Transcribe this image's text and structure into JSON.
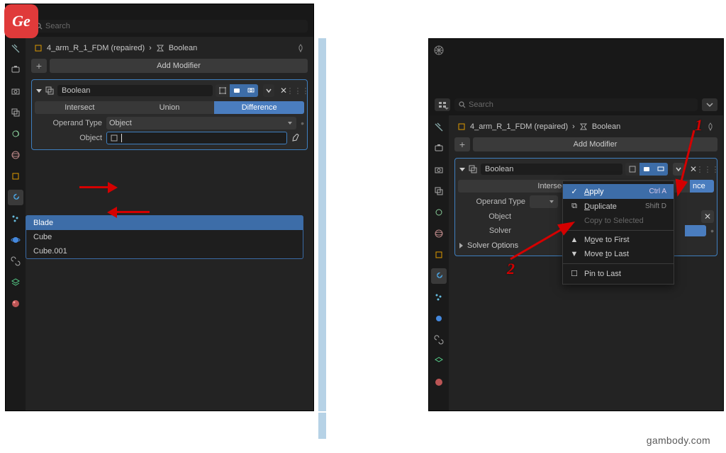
{
  "search_placeholder": "Search",
  "breadcrumb": {
    "object": "4_arm_R_1_FDM (repaired)",
    "modifier": "Boolean"
  },
  "add_modifier_label": "Add Modifier",
  "modifier": {
    "name": "Boolean",
    "operations": [
      "Intersect",
      "Union",
      "Difference"
    ],
    "active_op_index": 2,
    "operand_type_label": "Operand Type",
    "operand_type_value": "Object",
    "object_label": "Object",
    "object_value": "",
    "solver_label": "Solver",
    "solver_options_label": "Solver Options"
  },
  "popup_objects": [
    "Blade",
    "Cube",
    "Cube.001"
  ],
  "context_menu": [
    {
      "type": "item",
      "icon": "check",
      "label": "Apply",
      "shortcut": "Ctrl A",
      "sel": true,
      "underline": 0
    },
    {
      "type": "item",
      "icon": "dup",
      "label": "Duplicate",
      "shortcut": "Shift D",
      "underline": 0
    },
    {
      "type": "item",
      "icon": "",
      "label": "Copy to Selected",
      "disabled": true
    },
    {
      "type": "sep"
    },
    {
      "type": "item",
      "icon": "up",
      "label": "Move to First",
      "underline": 1
    },
    {
      "type": "item",
      "icon": "down",
      "label": "Move to Last",
      "underline": 6
    },
    {
      "type": "sep"
    },
    {
      "type": "item",
      "icon": "box",
      "label": "Pin to Last"
    }
  ],
  "markers": {
    "one": "1",
    "two": "2"
  },
  "logo_text": "Ge",
  "watermark": "gambody.com"
}
